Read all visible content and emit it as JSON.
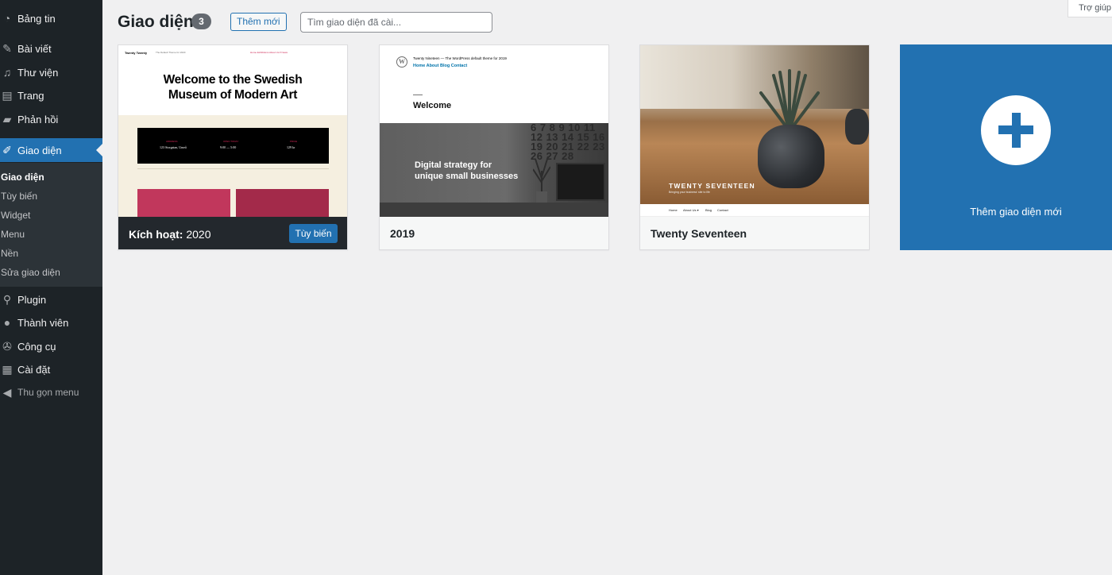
{
  "sidebar": {
    "items": [
      {
        "label": "Bảng tin",
        "icon": "dashboard-icon"
      },
      {
        "label": "Bài viết",
        "icon": "pin-icon"
      },
      {
        "label": "Thư viện",
        "icon": "media-icon"
      },
      {
        "label": "Trang",
        "icon": "page-icon"
      },
      {
        "label": "Phản hồi",
        "icon": "comment-icon"
      },
      {
        "label": "Giao diện",
        "icon": "brush-icon"
      },
      {
        "label": "Plugin",
        "icon": "plugin-icon"
      },
      {
        "label": "Thành viên",
        "icon": "user-icon"
      },
      {
        "label": "Công cụ",
        "icon": "wrench-icon"
      },
      {
        "label": "Cài đặt",
        "icon": "settings-icon"
      },
      {
        "label": "Thu gọn menu",
        "icon": "collapse-icon"
      }
    ],
    "submenu": [
      "Giao diện",
      "Tùy biến",
      "Widget",
      "Menu",
      "Nền",
      "Sửa giao diện"
    ]
  },
  "header": {
    "title": "Giao diện",
    "count": "3",
    "add_new": "Thêm mới",
    "search_placeholder": "Tìm giao diện đã cài...",
    "help": "Trợ giúp"
  },
  "themes": {
    "t2020": {
      "active_prefix": "Kích hoạt:",
      "name": "2020",
      "customize": "Tùy biến",
      "shot": {
        "logo": "Twenty Twenty",
        "tagline": "The Default Theme for 2020",
        "nav": "Home   Exhibitions   About Us ▾   News",
        "heading_line1": "Welcome to the Swedish",
        "heading_line2": "Museum of Modern Art",
        "address_label": "ADDRESS",
        "address": "123 Storgatan, Umeå",
        "hours_label": "OPEN TODAY",
        "hours": "9:00 — 5:00",
        "price_label": "PRICE",
        "price": "129 kr"
      }
    },
    "t2019": {
      "name": "2019",
      "shot": {
        "wp_logo": "W",
        "site_name": "Twenty Nineteen — The WordPress default theme for 2019",
        "nav": "Home   About   Blog   Contact",
        "welcome": "Welcome",
        "hero_line1": "Digital strategy for",
        "hero_line2": "unique small businesses",
        "calendar": "6 7 8 9 10 11\n12 13 14 15 16 17\n19 20 21 22 23 24\n26 27 28"
      }
    },
    "t2017": {
      "name": "Twenty Seventeen",
      "shot": {
        "title": "TWENTY SEVENTEEN",
        "tagline": "Bringing your business' site to life",
        "nav_home": "Home",
        "nav_about": "About Us ▾",
        "nav_blog": "Blog",
        "nav_contact": "Contact"
      }
    },
    "add_new": {
      "label": "Thêm giao diện mới"
    }
  },
  "colors": {
    "sidebar_bg": "#1d2327",
    "accent": "#2271b1",
    "page_bg": "#f0f0f1"
  }
}
